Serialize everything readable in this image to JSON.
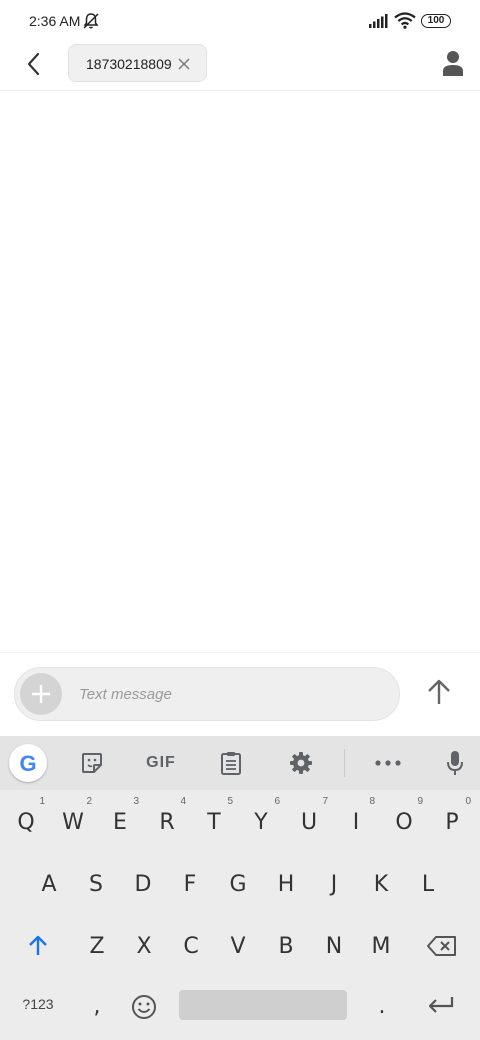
{
  "status_bar": {
    "time": "2:36 AM",
    "battery": "100"
  },
  "header": {
    "recipient": "18730218809"
  },
  "compose": {
    "placeholder": "Text message"
  },
  "keyboard": {
    "toolbar": {
      "gif_label": "GIF"
    },
    "row1": [
      {
        "label": "Q",
        "hint": "1"
      },
      {
        "label": "W",
        "hint": "2"
      },
      {
        "label": "E",
        "hint": "3"
      },
      {
        "label": "R",
        "hint": "4"
      },
      {
        "label": "T",
        "hint": "5"
      },
      {
        "label": "Y",
        "hint": "6"
      },
      {
        "label": "U",
        "hint": "7"
      },
      {
        "label": "I",
        "hint": "8"
      },
      {
        "label": "O",
        "hint": "9"
      },
      {
        "label": "P",
        "hint": "0"
      }
    ],
    "row2": [
      "A",
      "S",
      "D",
      "F",
      "G",
      "H",
      "J",
      "K",
      "L"
    ],
    "row3": [
      "Z",
      "X",
      "C",
      "V",
      "B",
      "N",
      "M"
    ],
    "row4": {
      "symbols_label": "?123",
      "comma": ",",
      "period": "."
    }
  },
  "colors": {
    "accent": "#1a73e8",
    "keyboard_bg": "#ececec"
  },
  "icons": [
    "back-arrow-icon",
    "close-icon",
    "contact-person-icon",
    "plus-icon",
    "send-arrow-icon",
    "sticker-icon",
    "clipboard-icon",
    "gear-icon",
    "more-dots-icon",
    "mic-icon",
    "shift-arrow-icon",
    "backspace-icon",
    "emoji-icon",
    "enter-icon",
    "bell-off-icon",
    "signal-icon",
    "wifi-icon",
    "battery-icon"
  ]
}
